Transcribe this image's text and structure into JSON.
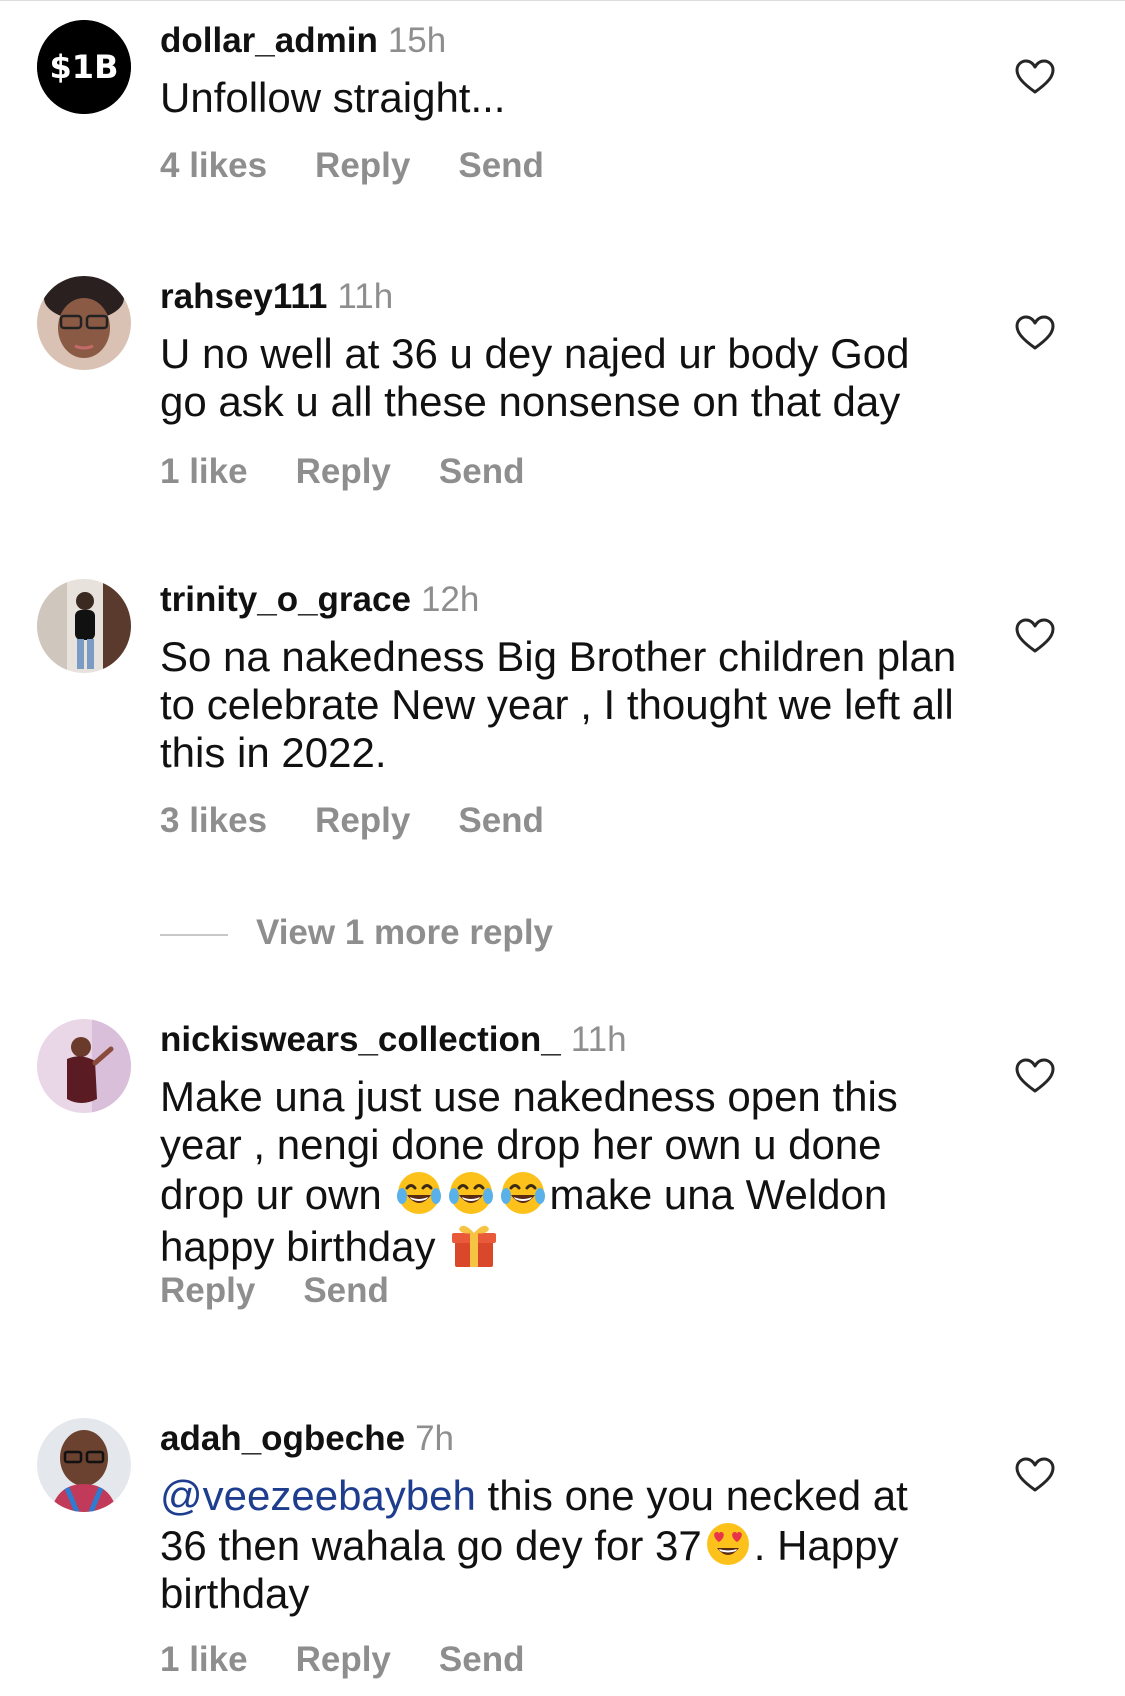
{
  "comments": [
    {
      "username": "dollar_admin",
      "time": "15h",
      "avatar_text": "$1B",
      "text": "Unfollow straight...",
      "likes": "4 likes",
      "reply": "Reply",
      "send": "Send"
    },
    {
      "username": "rahsey111",
      "time": "11h",
      "text": "U no well at 36 u dey najed ur body God go ask u all these nonsense on that day",
      "likes": "1 like",
      "reply": "Reply",
      "send": "Send"
    },
    {
      "username": "trinity_o_grace",
      "time": "12h",
      "text": "So na nakedness Big Brother children plan to celebrate New year , I thought we left all this in 2022.",
      "likes": "3 likes",
      "reply": "Reply",
      "send": "Send"
    },
    {
      "username": "nickiswears_collection_",
      "time": "11h",
      "text_part1": "Make una just use nakedness open this year , nengi done drop her own u done drop ur own ",
      "text_part2": "make una Weldon happy birthday ",
      "reply": "Reply",
      "send": "Send"
    },
    {
      "username": "adah_ogbeche",
      "time": "7h",
      "mention": "@veezeebaybeh",
      "text_part1": " this one you necked at 36 then wahala go dey for 37",
      "text_part2": ". Happy birthday",
      "likes": "1 like",
      "reply": "Reply",
      "send": "Send"
    }
  ],
  "view_more_replies": "View 1 more reply",
  "colors": {
    "secondary_text": "#8e8e8e",
    "mention": "#1e3d8f",
    "divider": "#c8c8c8"
  },
  "icons": [
    "heart-outline-icon",
    "laughing-crying-emoji",
    "gift-emoji",
    "heart-eyes-emoji"
  ]
}
